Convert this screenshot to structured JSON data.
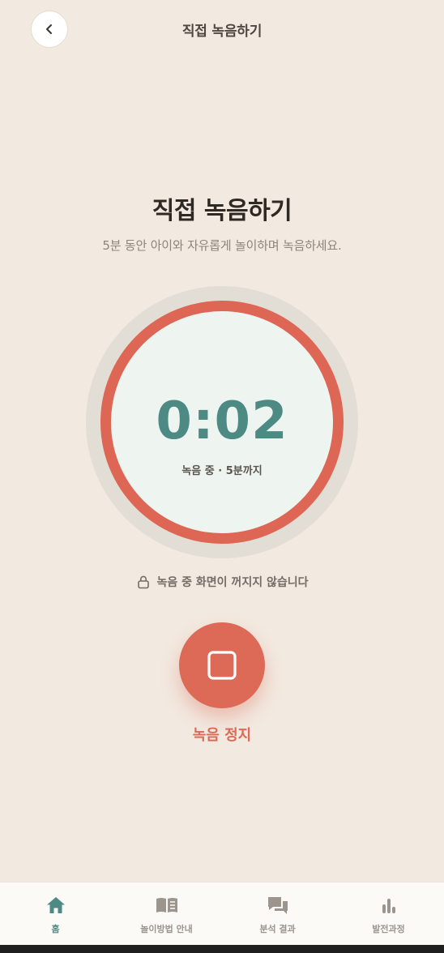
{
  "header": {
    "title": "직접 녹음하기"
  },
  "intro": {
    "title": "직접 녹음하기",
    "subtitle": "5분 동안 아이와 자유롭게 놀이하며 녹음하세요."
  },
  "timer": {
    "elapsed": "0:02",
    "caption": "녹음 중 · 5분까지"
  },
  "notice": {
    "text": "녹음 중 화면이 꺼지지 않습니다",
    "icon": "lock-icon"
  },
  "stop": {
    "label": "녹음 정지",
    "icon": "stop-square-icon"
  },
  "bottom_nav": {
    "items": [
      {
        "label": "홈",
        "icon": "home-icon",
        "active": true
      },
      {
        "label": "놀이방법 안내",
        "icon": "book-icon",
        "active": false
      },
      {
        "label": "분석 결과",
        "icon": "chat-bubbles-icon",
        "active": false
      },
      {
        "label": "발전과정",
        "icon": "bar-chart-icon",
        "active": false
      }
    ]
  },
  "colors": {
    "background": "#f2e9e0",
    "accent_coral": "#dd6a57",
    "accent_teal": "#4d8a84",
    "timer_face": "#eef5f1"
  }
}
